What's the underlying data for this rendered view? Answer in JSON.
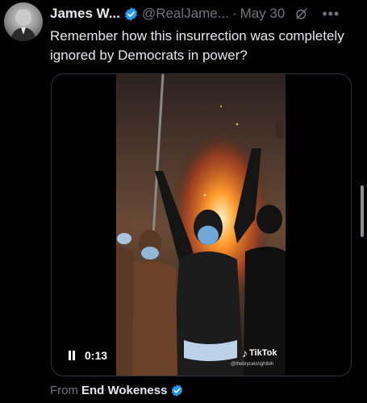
{
  "tweet": {
    "author_name": "James W...",
    "author_handle": "@RealJame...",
    "separator": "·",
    "date": "May 30",
    "text": "Remember how this insurrection was completely ignored by Democrats in power?"
  },
  "video": {
    "time": "0:13",
    "watermark": "TikTok",
    "watermark_handle": "@thebryceisrightbih"
  },
  "source": {
    "prefix": "From",
    "account": "End Wokeness"
  },
  "colors": {
    "verified_blue": "#1d9bf0",
    "text_primary": "#e7e9ea",
    "text_secondary": "#71767b"
  },
  "icons": [
    "verified-badge-icon",
    "grok-icon",
    "more-icon",
    "pause-icon",
    "tiktok-icon"
  ]
}
